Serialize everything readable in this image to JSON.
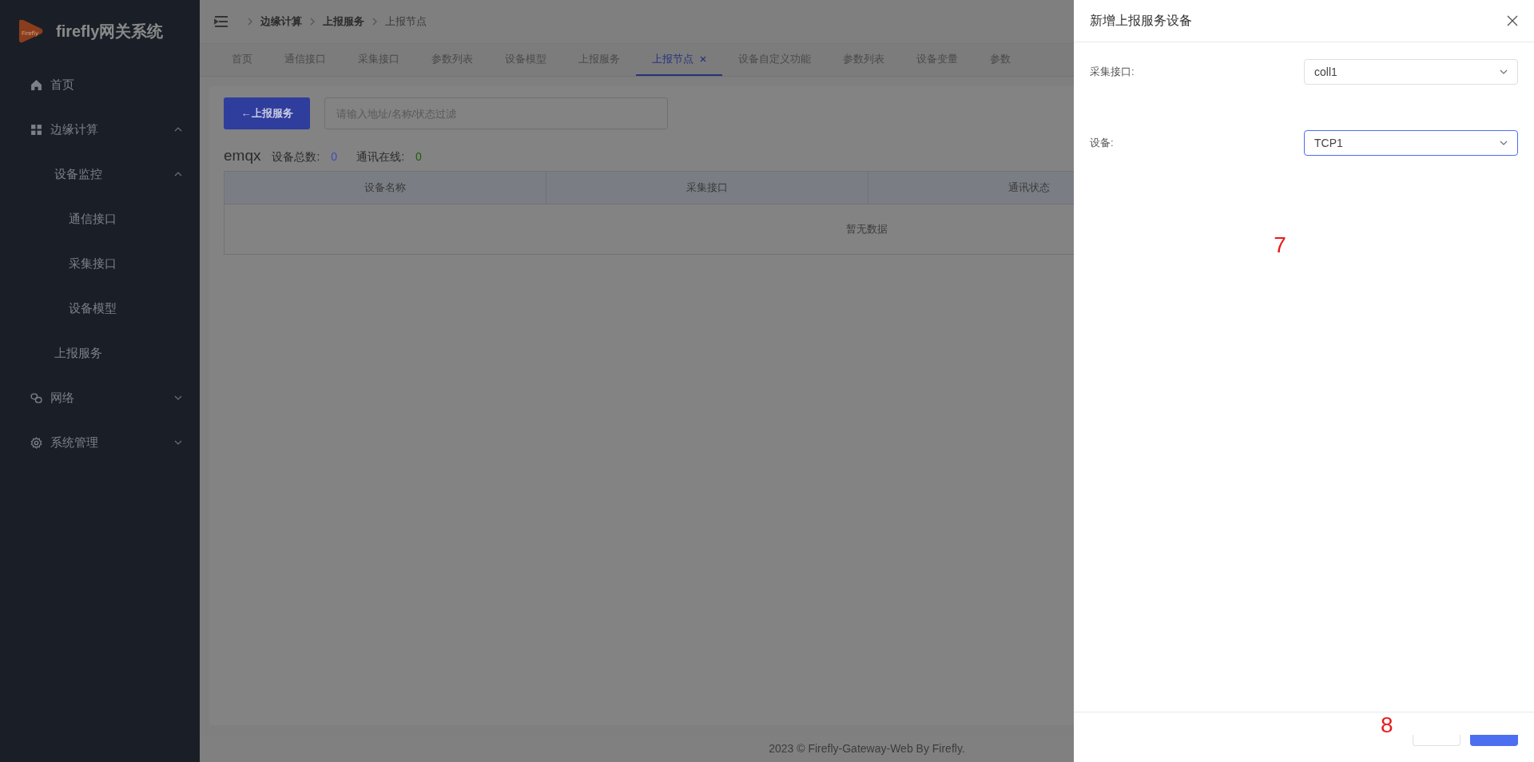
{
  "sidebar": {
    "logo_mark": "Firefly",
    "title": "firefly网关系统",
    "items": [
      {
        "label": "首页"
      },
      {
        "label": "边缘计算",
        "expanded": true,
        "children": [
          {
            "label": "设备监控",
            "expanded": true,
            "children": [
              {
                "label": "通信接口"
              },
              {
                "label": "采集接口"
              },
              {
                "label": "设备模型"
              }
            ]
          },
          {
            "label": "上报服务"
          }
        ]
      },
      {
        "label": "网络",
        "expanded": false
      },
      {
        "label": "系统管理",
        "expanded": false
      }
    ]
  },
  "breadcrumb": [
    "边缘计算",
    "上报服务",
    "上报节点"
  ],
  "tabs": [
    {
      "label": "首页",
      "selected": false
    },
    {
      "label": "通信接口",
      "selected": false
    },
    {
      "label": "采集接口",
      "selected": false
    },
    {
      "label": "参数列表",
      "selected": false
    },
    {
      "label": "设备模型",
      "selected": false
    },
    {
      "label": "上报服务",
      "selected": false
    },
    {
      "label": "上报节点",
      "selected": true
    },
    {
      "label": "设备自定义功能",
      "selected": false
    },
    {
      "label": "参数列表",
      "selected": false
    },
    {
      "label": "设备变量",
      "selected": false
    },
    {
      "label": "参数",
      "selected": false
    }
  ],
  "toolbar": {
    "back_button": "←上报服务",
    "filter": {
      "placeholder": "请输入地址/名称/状态过滤"
    }
  },
  "summary": {
    "name": "emqx",
    "stats": [
      {
        "label": "设备总数:",
        "value": "0",
        "color": "#3b4bbd"
      },
      {
        "label": "通讯在线:",
        "value": "0",
        "color": "#1c5e08"
      }
    ]
  },
  "table": {
    "columns": [
      "设备名称",
      "采集接口",
      "通讯状态"
    ],
    "empty_text": "暂无数据"
  },
  "footer": "2023 © Firefly-Gateway-Web By Firefly.",
  "drawer": {
    "title": "新增上报服务设备",
    "fields": [
      {
        "label": "采集接口:",
        "value": "coll1",
        "focused": false
      },
      {
        "label": "设备:",
        "value": "TCP1",
        "focused": true
      }
    ],
    "buttons": [
      {
        "kind": "cancel"
      },
      {
        "kind": "primary"
      }
    ]
  },
  "annotations": [
    {
      "text": "7"
    },
    {
      "text": "8"
    }
  ]
}
